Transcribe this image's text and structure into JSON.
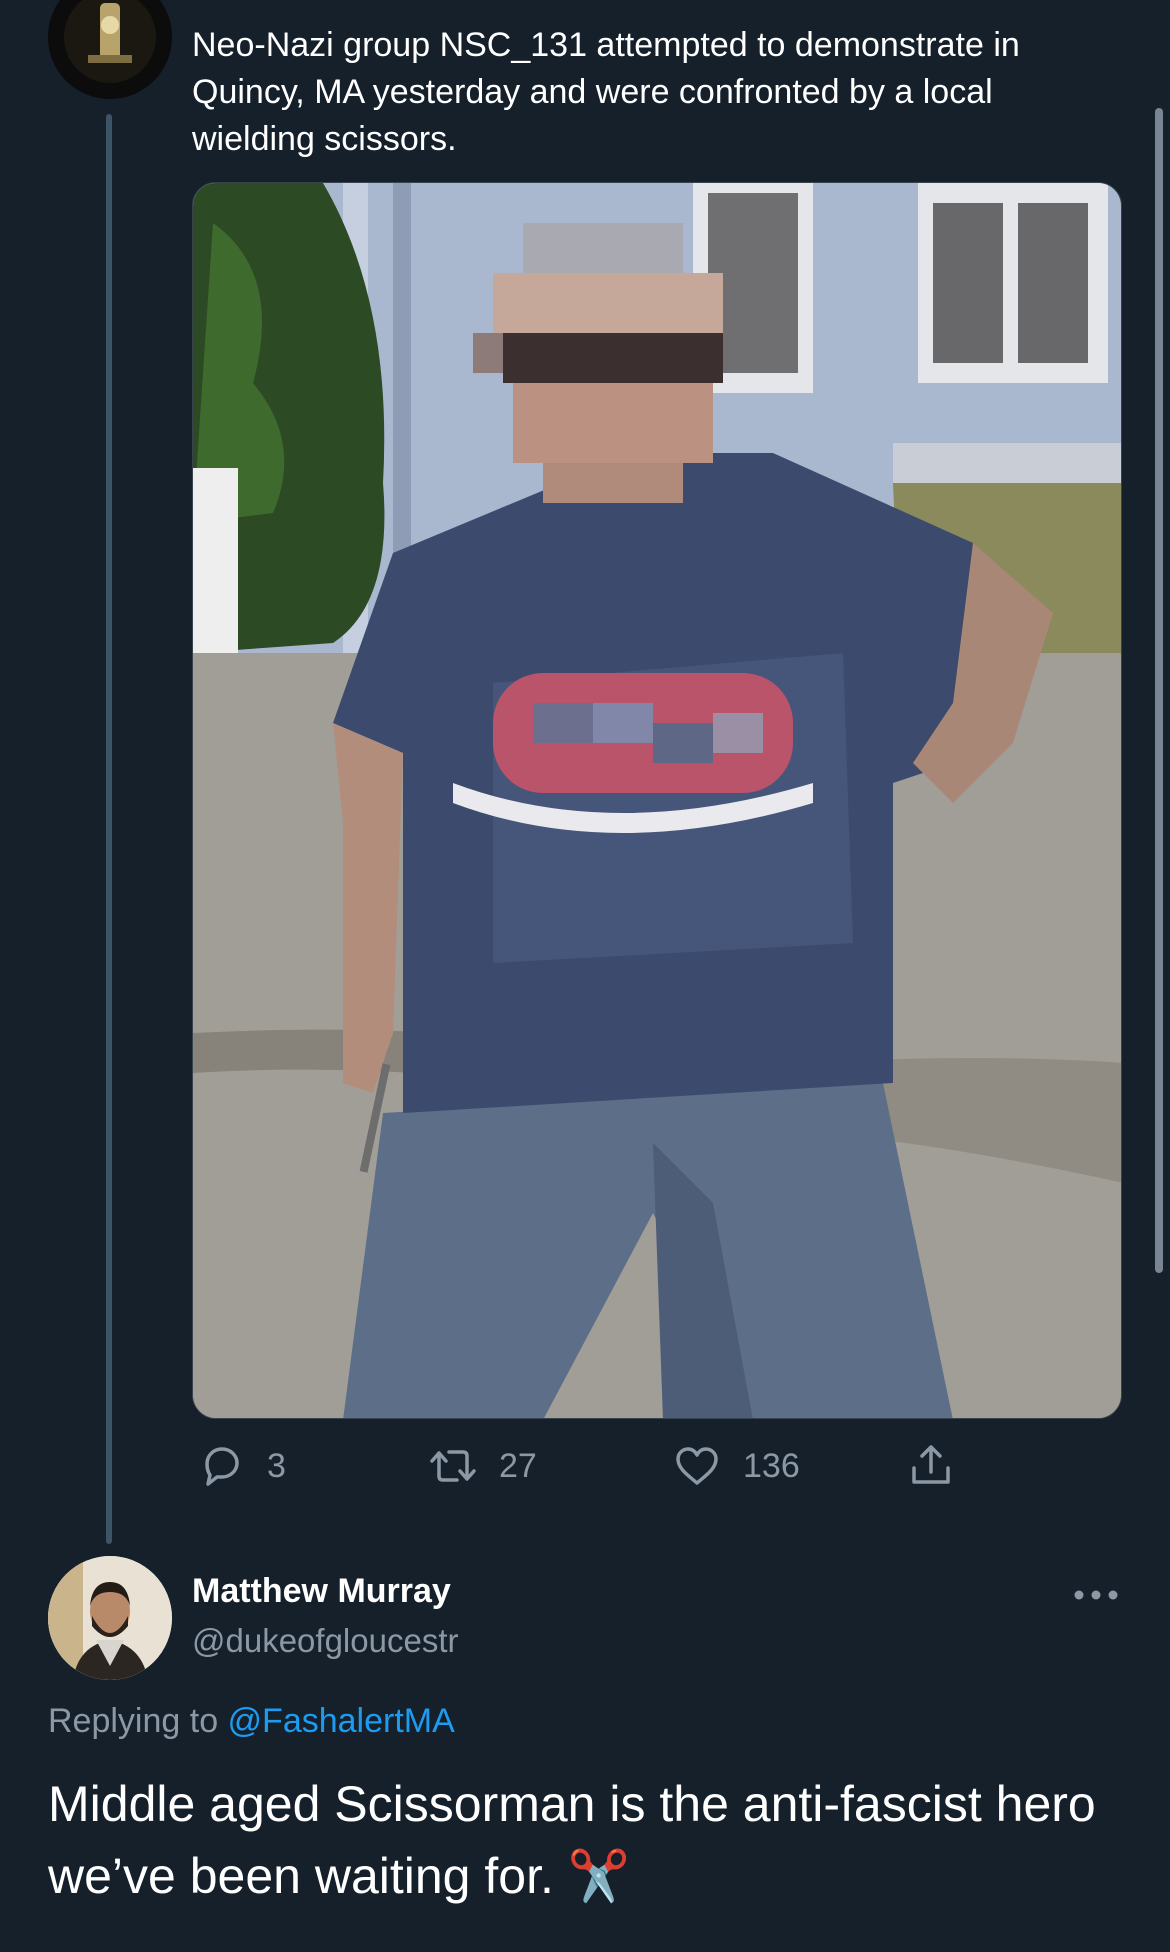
{
  "original_tweet": {
    "text": "Neo-Nazi group NSC_131 attempted to demonstrate in Quincy, MA yesterday and were confronted by a local wielding scissors.",
    "media": {
      "description_icon": "photo"
    },
    "actions": {
      "replies": "3",
      "retweets": "27",
      "likes": "136"
    }
  },
  "reply_tweet": {
    "author": {
      "name": "Matthew Murray",
      "handle": "@dukeofgloucestr"
    },
    "replying_to_label": "Replying to ",
    "replying_to_handle": "@FashalertMA",
    "text": "Middle aged Scissorman is the anti-fascist hero we’ve been waiting for. ✂️"
  },
  "colors": {
    "background": "#15202b",
    "text_primary": "#ffffff",
    "text_secondary": "#8b98a5",
    "link": "#1d9bf0",
    "thread_line": "#3d5466"
  },
  "icons": {
    "reply": "reply-icon",
    "retweet": "retweet-icon",
    "like": "heart-icon",
    "share": "share-icon",
    "more": "more-icon"
  }
}
